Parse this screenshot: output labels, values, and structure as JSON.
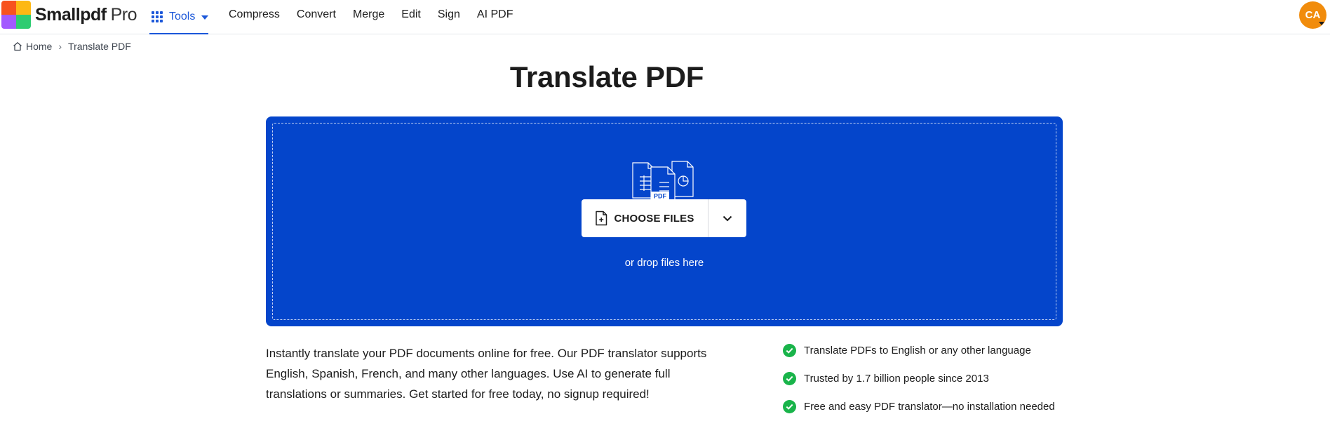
{
  "header": {
    "brand": "Smallpdf",
    "plan": "Pro",
    "logo_colors": [
      "#f7531f",
      "#fdb813",
      "#a259ff",
      "#2ecc71"
    ],
    "tools_label": "Tools",
    "nav_items": [
      "Compress",
      "Convert",
      "Merge",
      "Edit",
      "Sign",
      "AI PDF"
    ],
    "avatar_initials": "CA",
    "avatar_color": "#f18c0c",
    "accent_color": "#1b57d9"
  },
  "breadcrumb": {
    "home": "Home",
    "current": "Translate PDF"
  },
  "main": {
    "title": "Translate PDF",
    "dropzone_color": "#0445cb",
    "illustration_label": "PDF",
    "choose_files_label": "CHOOSE FILES",
    "drop_text": "or drop files here",
    "description": "Instantly translate your PDF documents online for free. Our PDF translator supports English, Spanish, French, and many other languages. Use AI to generate full translations or summaries. Get started for free today, no signup required!",
    "benefits": [
      "Translate PDFs to English or any other language",
      "Trusted by 1.7 billion people since 2013",
      "Free and easy PDF translator—no installation needed"
    ],
    "check_color": "#19b44a"
  }
}
